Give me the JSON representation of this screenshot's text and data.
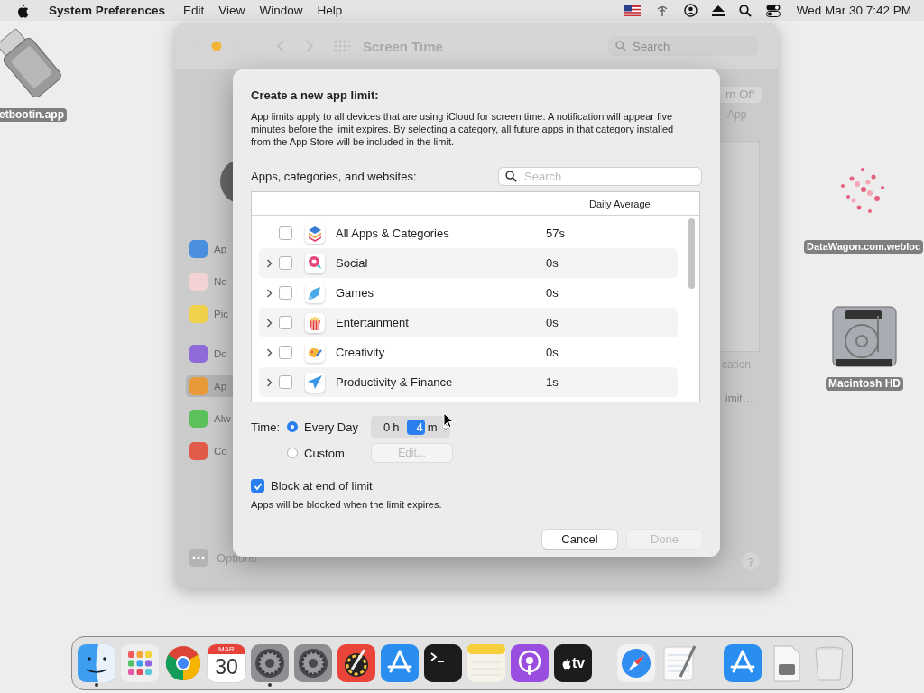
{
  "menubar": {
    "app_name": "System Preferences",
    "menus": [
      "Edit",
      "View",
      "Window",
      "Help"
    ],
    "clock": "Wed Mar 30  7:42 PM"
  },
  "desktop_icons": [
    {
      "kind": "usb",
      "label": "etbootin.app"
    },
    {
      "kind": "picture",
      "label": "DataWagon.com.webloc"
    },
    {
      "kind": "disk",
      "label": "Macintosh HD"
    }
  ],
  "back_window": {
    "title": "Screen Time",
    "search_placeholder": "Search",
    "sidebar_top": [
      {
        "label": "Ap",
        "color": "#4a8fe0",
        "selected": false
      },
      {
        "label": "No",
        "color": "#f2d2d2",
        "selected": false
      },
      {
        "label": "Pic",
        "color": "#f0d24a",
        "selected": false
      }
    ],
    "sidebar_bottom": [
      {
        "label": "Do",
        "color": "#8e6bd8",
        "selected": false
      },
      {
        "label": "Ap",
        "color": "#e89a3a",
        "selected": true
      },
      {
        "label": "Alw",
        "color": "#5cc05c",
        "selected": false
      },
      {
        "label": "Co",
        "color": "#e25a4a",
        "selected": false
      }
    ],
    "options": "Options",
    "turn_off_button": "rn Off",
    "app_text": "App",
    "cation_text": "cation",
    "limit_text": "imit…",
    "help": "?"
  },
  "dialog": {
    "title": "Create a new app limit:",
    "description": "App limits apply to all devices that are using iCloud for screen time. A notification will appear five minutes before the limit expires. By selecting a category, all future apps in that category installed from the App Store will be included in the limit.",
    "list_label": "Apps, categories, and websites:",
    "search_placeholder": "Search",
    "column_header": "Daily Average",
    "rows": [
      {
        "kind": "stack",
        "label": "All Apps & Categories",
        "value": "57s",
        "expandable": false,
        "checked": false
      },
      {
        "kind": "social",
        "label": "Social",
        "value": "0s",
        "expandable": true,
        "checked": false
      },
      {
        "kind": "games",
        "label": "Games",
        "value": "0s",
        "expandable": true,
        "checked": false
      },
      {
        "kind": "entertainment",
        "label": "Entertainment",
        "value": "0s",
        "expandable": true,
        "checked": false
      },
      {
        "kind": "creativity",
        "label": "Creativity",
        "value": "0s",
        "expandable": true,
        "checked": false
      },
      {
        "kind": "productivity",
        "label": "Productivity & Finance",
        "value": "1s",
        "expandable": true,
        "checked": false
      }
    ],
    "time_label": "Time:",
    "time_options": [
      {
        "label": "Every Day",
        "selected": true
      },
      {
        "label": "Custom",
        "selected": false
      }
    ],
    "hours": "0",
    "hours_unit": "h",
    "minutes": "4",
    "minutes_unit": "m",
    "edit_button": {
      "label": "Edit...",
      "disabled": true
    },
    "block": {
      "label": "Block at end of limit",
      "checked": true
    },
    "note": "Apps will be blocked when the limit expires.",
    "buttons": [
      {
        "label": "Cancel",
        "disabled": false
      },
      {
        "label": "Done",
        "disabled": true
      }
    ]
  },
  "dock": {
    "items": [
      {
        "kind": "finder",
        "running": true
      },
      {
        "kind": "launchpad",
        "running": false
      },
      {
        "kind": "chrome",
        "running": false
      },
      {
        "kind": "calendar",
        "running": false,
        "month": "MAR",
        "day": "30"
      },
      {
        "kind": "settings",
        "running": true
      },
      {
        "kind": "settings",
        "running": false
      },
      {
        "kind": "colorpicker",
        "running": false
      },
      {
        "kind": "appstore",
        "running": false
      },
      {
        "kind": "terminal",
        "running": false
      },
      {
        "kind": "notes",
        "running": false
      },
      {
        "kind": "podcasts",
        "running": false
      },
      {
        "kind": "tv",
        "running": false,
        "label": "tv"
      },
      {
        "kind": "divider"
      },
      {
        "kind": "safari",
        "running": false
      },
      {
        "kind": "textedit",
        "running": false
      },
      {
        "kind": "divider"
      },
      {
        "kind": "appstore",
        "running": false
      },
      {
        "kind": "file",
        "running": false
      },
      {
        "kind": "trash",
        "running": false
      }
    ]
  }
}
